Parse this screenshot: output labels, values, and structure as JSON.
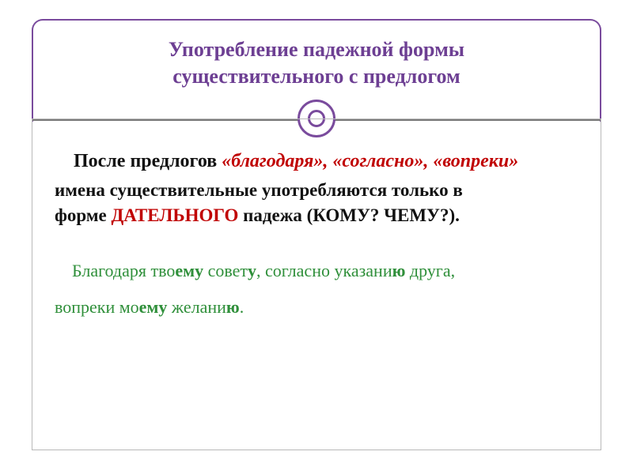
{
  "header": {
    "title_line1": "Употребление падежной формы",
    "title_line2": "существительного с предлогом"
  },
  "body": {
    "intro_prefix": "После предлогов ",
    "prep1": "«благодаря»",
    "sep": ", ",
    "prep2": "«согласно»",
    "prep3": "«вопреки»",
    "line2": "имена существительные употребляются только в",
    "line3_a": "форме ",
    "line3_red": "ДАТЕЛЬНОГО",
    "line3_b": " падежа",
    "line3_q": "   (КОМУ? ЧЕМУ?).",
    "ex1_a": "Благодаря тво",
    "ex1_b": "ему",
    "ex1_c": " совет",
    "ex1_d": "у",
    "ex1_e": ", согласно указани",
    "ex1_f": "ю",
    "ex1_g": " друга,",
    "ex2_a": "вопреки мо",
    "ex2_b": "ему",
    "ex2_c": " желани",
    "ex2_d": "ю",
    "ex2_e": "."
  }
}
